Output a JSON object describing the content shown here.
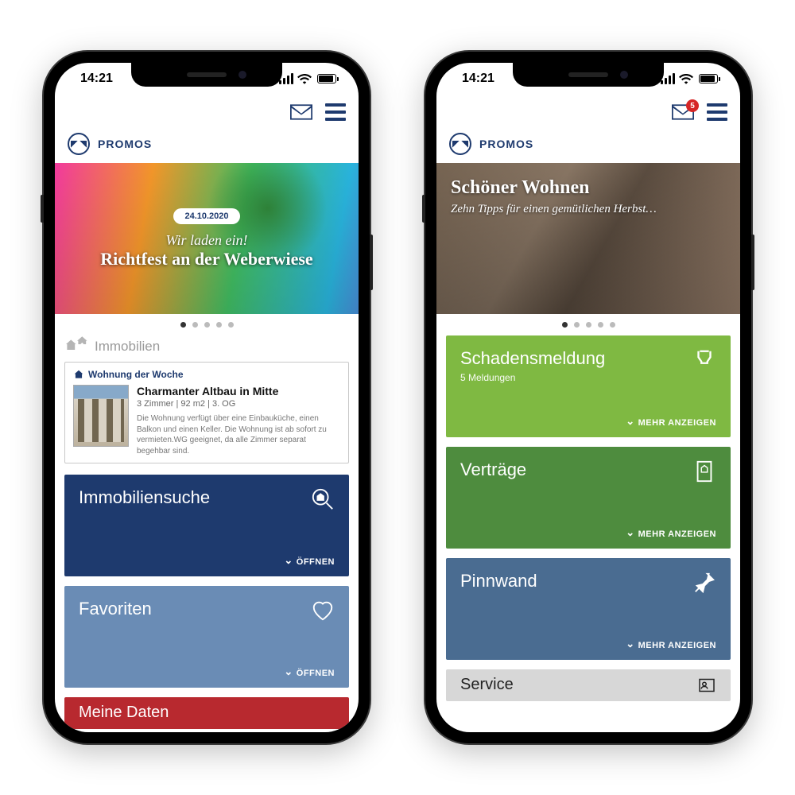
{
  "status": {
    "time": "14:21"
  },
  "brand": {
    "name": "PROMOS"
  },
  "mail_badge": "5",
  "phone1": {
    "hero": {
      "date": "24.10.2020",
      "subtitle": "Wir laden ein!",
      "title": "Richtfest an der Weberwiese"
    },
    "pager": {
      "count": 5,
      "active": 0
    },
    "section_label": "Immobilien",
    "listing": {
      "badge": "Wohnung der Woche",
      "title": "Charmanter Altbau in Mitte",
      "meta": "3 Zimmer | 92 m2 | 3. OG",
      "desc": "Die Wohnung verfügt über eine Einbauküche, einen Balkon und einen Keller. Die Wohnung ist ab sofort zu vermieten.WG geeignet, da alle Zimmer separat begehbar sind."
    },
    "tiles": [
      {
        "title": "Immobiliensuche",
        "action": "ÖFFNEN",
        "color": "c-darkblue",
        "icon": "search-home"
      },
      {
        "title": "Favoriten",
        "action": "ÖFFNEN",
        "color": "c-lightblue",
        "icon": "heart"
      },
      {
        "title": "Meine Daten",
        "action": "",
        "color": "c-red",
        "icon": ""
      }
    ]
  },
  "phone2": {
    "hero": {
      "title": "Schöner Wohnen",
      "subtitle": "Zehn Tipps für einen gemütlichen Herbst…"
    },
    "pager": {
      "count": 5,
      "active": 0
    },
    "tiles": [
      {
        "title": "Schadensmeldung",
        "sub": "5 Meldungen",
        "action": "MEHR ANZEIGEN",
        "color": "c-lime",
        "icon": "wrench"
      },
      {
        "title": "Verträge",
        "action": "MEHR ANZEIGEN",
        "color": "c-green",
        "icon": "document"
      },
      {
        "title": "Pinnwand",
        "action": "MEHR ANZEIGEN",
        "color": "c-steel",
        "icon": "pin"
      },
      {
        "title": "Service",
        "action": "",
        "color": "c-grey",
        "icon": "contact"
      }
    ]
  }
}
